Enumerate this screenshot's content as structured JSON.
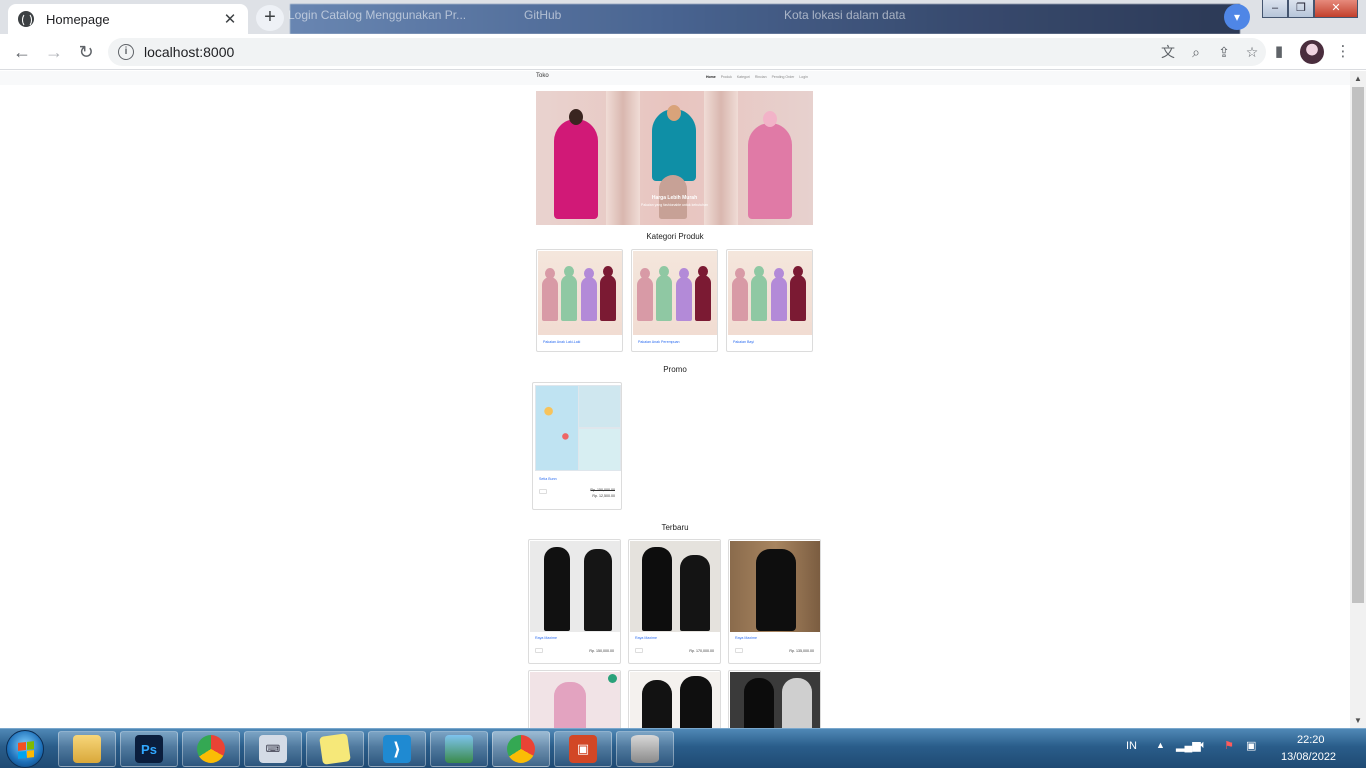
{
  "browser": {
    "active_tab_title": "Homepage",
    "background_tabs": [
      "Login Catalog Menggunakan Pr...",
      "GitHub",
      "Kota lokasi dalam data"
    ],
    "url": "localhost:8000",
    "window_controls": {
      "minimize": "–",
      "maximize": "❐",
      "close": "✕"
    }
  },
  "site": {
    "brand": "Toko",
    "nav": [
      "Home",
      "Produk",
      "Kategori",
      "Rincian",
      "Pending Order",
      "Login"
    ],
    "hero": {
      "caption_title": "Harga Lebih Murah",
      "caption_sub": "Pakaian yang fashionable untuk kebutuhan"
    },
    "sections": {
      "categories_title": "Kategori Produk",
      "promo_title": "Promo",
      "latest_title": "Terbaru"
    },
    "categories": [
      {
        "name": "Pakaian Anak Laki-Laki"
      },
      {
        "name": "Pakaian Anak Perempuan"
      },
      {
        "name": "Pakaian Bayi"
      }
    ],
    "promo": [
      {
        "name": "Setia Bunn",
        "old_price": "Rp. 150,000.00",
        "price": "Rp. 12,500.00"
      }
    ],
    "latest": [
      {
        "name": "Raya Maxime",
        "price": "Rp. 150,000.00"
      },
      {
        "name": "Raya Maxime",
        "price": "Rp. 170,000.00"
      },
      {
        "name": "Raya Maxime",
        "price": "Rp. 135,000.00"
      }
    ]
  },
  "taskbar": {
    "apps": [
      "windows-explorer",
      "photoshop",
      "chrome",
      "on-screen-keyboard",
      "sticky-notes",
      "vscode",
      "image-viewer",
      "chrome",
      "powerpoint",
      "database"
    ],
    "ps_label": "Ps",
    "language": "IN",
    "time": "22:20",
    "date": "13/08/2022"
  },
  "colors": {
    "link_blue": "#2b6cf0",
    "taskbar": "#2a5d8a"
  }
}
